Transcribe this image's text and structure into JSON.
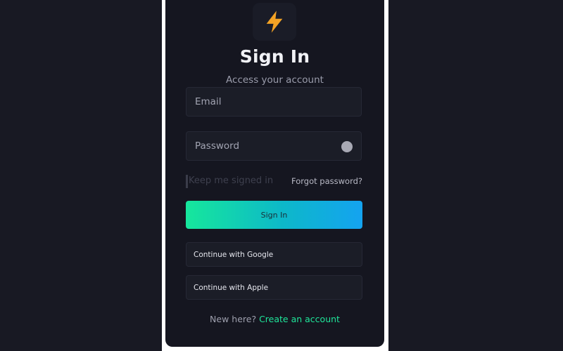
{
  "brand": {
    "icon": "lightning-bolt-icon",
    "accent": "#1fe59a"
  },
  "header": {
    "title": "Sign In",
    "subtitle": "Access your account"
  },
  "form": {
    "email_placeholder": "Email",
    "password_placeholder": "Password",
    "password_toggle_icon": "eye-toggle-icon",
    "remember_label": "Keep me signed in",
    "forgot_label": "Forgot password?",
    "submit_label": "Sign In"
  },
  "oauth": {
    "google_label": "Continue with Google",
    "apple_label": "Continue with Apple"
  },
  "footer": {
    "prompt": "New here?",
    "link_label": "Create an account"
  },
  "colors": {
    "background": "#181923",
    "card": "#151620",
    "gradient_start": "#16e79c",
    "gradient_end": "#14a3f0",
    "bolt": "#f4a325"
  }
}
